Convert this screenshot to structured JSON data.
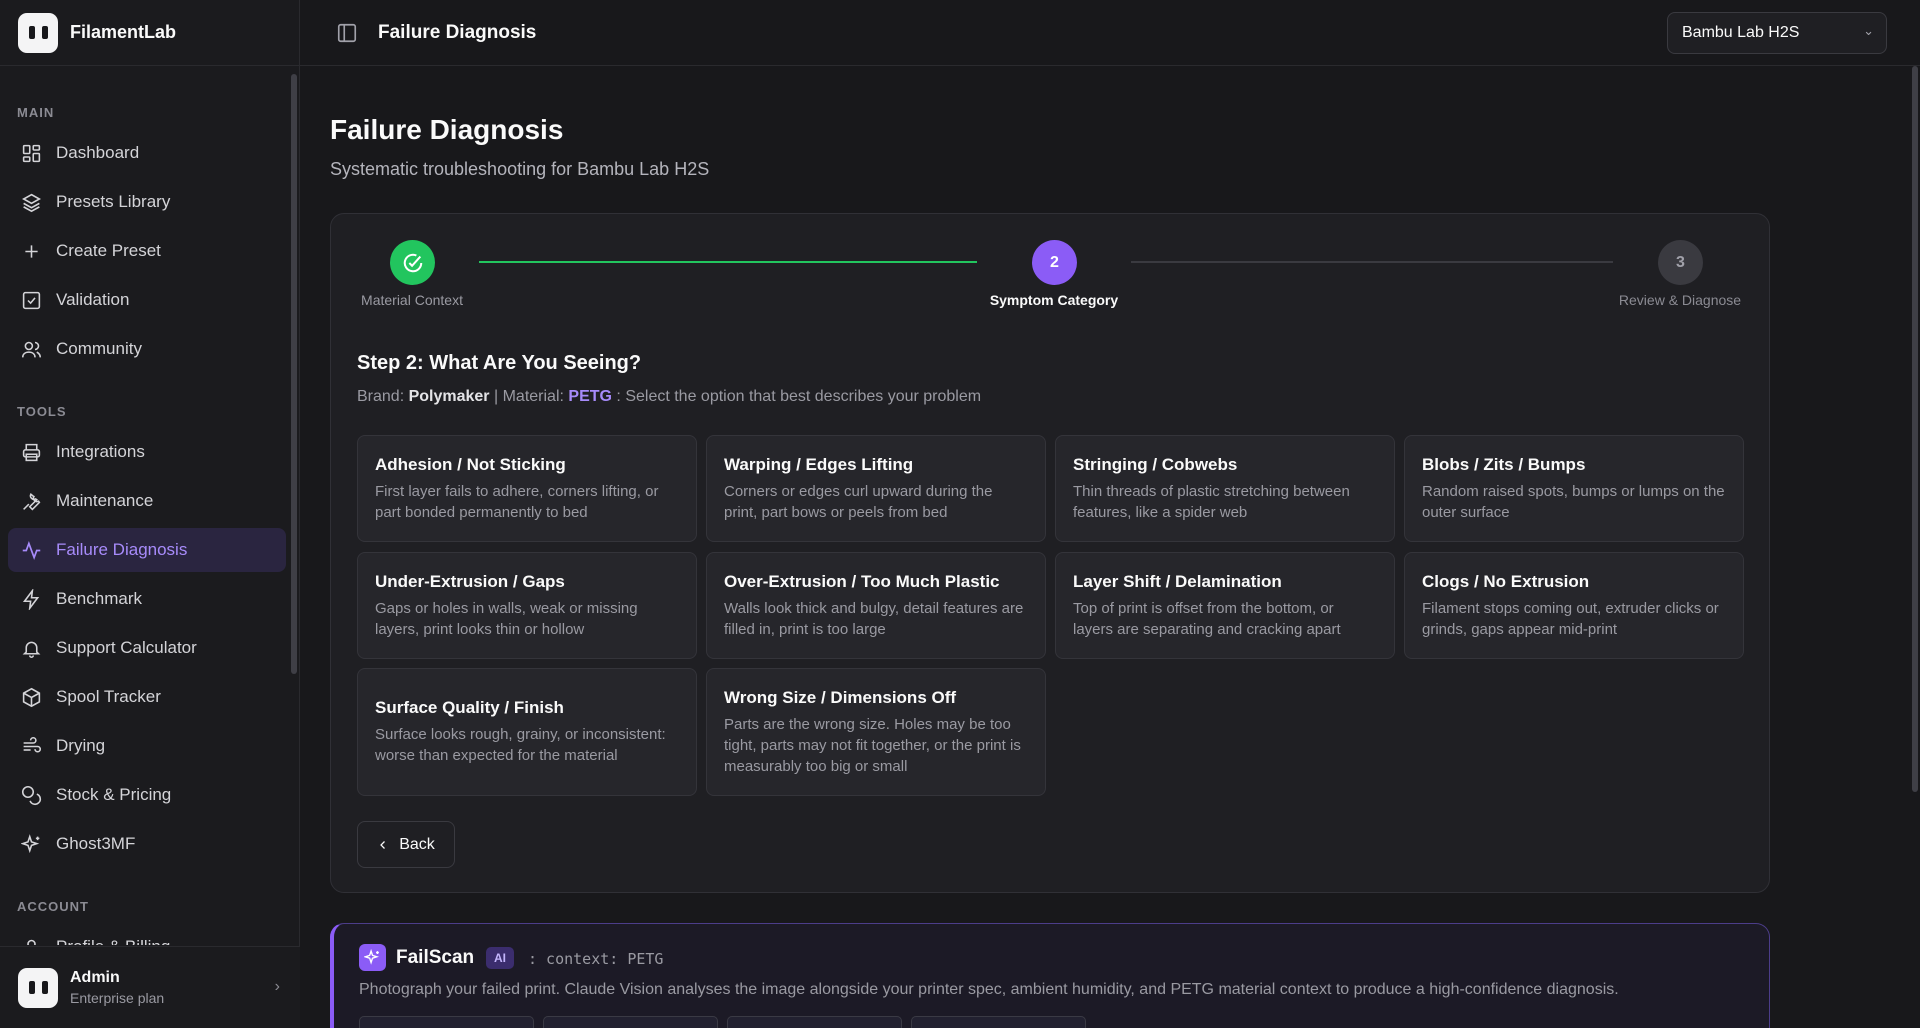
{
  "app": {
    "name": "FilamentLab"
  },
  "sidebar": {
    "sections": {
      "main": "MAIN",
      "tools": "TOOLS",
      "account": "ACCOUNT"
    },
    "main_items": [
      {
        "label": "Dashboard",
        "icon": "dashboard-icon"
      },
      {
        "label": "Presets Library",
        "icon": "layers-icon"
      },
      {
        "label": "Create Preset",
        "icon": "plus-icon"
      },
      {
        "label": "Validation",
        "icon": "checkbox-icon"
      },
      {
        "label": "Community",
        "icon": "users-icon"
      }
    ],
    "tool_items": [
      {
        "label": "Integrations",
        "icon": "printer-icon"
      },
      {
        "label": "Maintenance",
        "icon": "wrench-icon"
      },
      {
        "label": "Failure Diagnosis",
        "icon": "activity-icon",
        "active": true
      },
      {
        "label": "Benchmark",
        "icon": "zap-icon"
      },
      {
        "label": "Support Calculator",
        "icon": "bell-icon"
      },
      {
        "label": "Spool Tracker",
        "icon": "box-icon"
      },
      {
        "label": "Drying",
        "icon": "wind-icon"
      },
      {
        "label": "Stock & Pricing",
        "icon": "coins-icon"
      },
      {
        "label": "Ghost3MF",
        "icon": "sparkles-icon"
      }
    ],
    "account_items": [
      {
        "label": "Profile & Billing",
        "icon": "user-icon"
      }
    ],
    "user": {
      "name": "Admin",
      "plan": "Enterprise plan"
    }
  },
  "topbar": {
    "title": "Failure Diagnosis",
    "printer_select": "Bambu Lab H2S"
  },
  "page": {
    "title": "Failure Diagnosis",
    "subtitle": "Systematic troubleshooting for Bambu Lab H2S"
  },
  "stepper": {
    "steps": [
      {
        "label": "Material Context",
        "state": "done"
      },
      {
        "label": "Symptom Category",
        "number": "2",
        "state": "current"
      },
      {
        "label": "Review & Diagnose",
        "number": "3",
        "state": "pending"
      }
    ]
  },
  "step2": {
    "heading": "Step 2: What Are You Seeing?",
    "brand_label": "Brand:",
    "brand": "Polymaker",
    "separator": "|",
    "material_label": "Material:",
    "material": "PETG",
    "instruction": ": Select the option that best describes your problem",
    "options": [
      {
        "title": "Adhesion / Not Sticking",
        "desc": "First layer fails to adhere, corners lifting, or part bonded permanently to bed"
      },
      {
        "title": "Warping / Edges Lifting",
        "desc": "Corners or edges curl upward during the print, part bows or peels from bed"
      },
      {
        "title": "Stringing / Cobwebs",
        "desc": "Thin threads of plastic stretching between features, like a spider web"
      },
      {
        "title": "Blobs / Zits / Bumps",
        "desc": "Random raised spots, bumps or lumps on the outer surface"
      },
      {
        "title": "Under-Extrusion / Gaps",
        "desc": "Gaps or holes in walls, weak or missing layers, print looks thin or hollow"
      },
      {
        "title": "Over-Extrusion / Too Much Plastic",
        "desc": "Walls look thick and bulgy, detail features are filled in, print is too large"
      },
      {
        "title": "Layer Shift / Delamination",
        "desc": "Top of print is offset from the bottom, or layers are separating and cracking apart"
      },
      {
        "title": "Clogs / No Extrusion",
        "desc": "Filament stops coming out, extruder clicks or grinds, gaps appear mid-print"
      },
      {
        "title": "Surface Quality / Finish",
        "desc": "Surface looks rough, grainy, or inconsistent: worse than expected for the material"
      },
      {
        "title": "Wrong Size / Dimensions Off",
        "desc": "Parts are the wrong size. Holes may be too tight, parts may not fit together, or the print is measurably too big or small"
      }
    ],
    "back_label": "Back"
  },
  "failscan": {
    "title": "FailScan",
    "badge": "AI",
    "context": ": context: PETG",
    "description": "Photograph your failed print. Claude Vision analyses the image alongside your printer spec, ambient humidity, and PETG material context to produce a high-confidence diagnosis."
  },
  "colors": {
    "accent": "#8b5cf6",
    "success": "#22c55e",
    "background": "#18181b"
  }
}
